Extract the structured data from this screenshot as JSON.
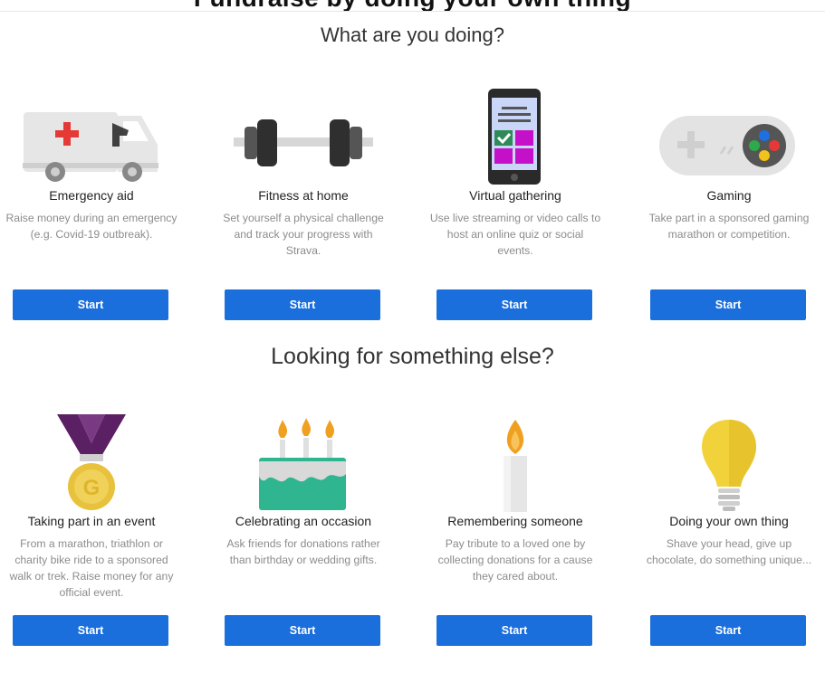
{
  "page": {
    "top_heading_partial": "Fundraise by doing your own thing",
    "section1_heading": "What are you doing?",
    "section2_heading": "Looking for something else?"
  },
  "section1": {
    "cards": [
      {
        "title": "Emergency aid",
        "desc": "Raise money during an emergency (e.g. Covid-19 outbreak).",
        "button": "Start",
        "icon": "ambulance-icon"
      },
      {
        "title": "Fitness at home",
        "desc": "Set yourself a physical challenge and track your progress with Strava.",
        "button": "Start",
        "icon": "dumbbell-icon"
      },
      {
        "title": "Virtual gathering",
        "desc": "Use live streaming or video calls to host an online quiz or social events.",
        "button": "Start",
        "icon": "smartphone-icon"
      },
      {
        "title": "Gaming",
        "desc": "Take part in a sponsored gaming marathon or competition.",
        "button": "Start",
        "icon": "gamepad-icon"
      }
    ]
  },
  "section2": {
    "cards": [
      {
        "title": "Taking part in an event",
        "desc": "From a marathon, triathlon or charity bike ride to a sponsored walk or trek. Raise money for any official event.",
        "button": "Start",
        "icon": "medal-icon"
      },
      {
        "title": "Celebrating an occasion",
        "desc": "Ask friends for donations rather than birthday or wedding gifts.",
        "button": "Start",
        "icon": "cake-icon"
      },
      {
        "title": "Remembering someone",
        "desc": "Pay tribute to a loved one by collecting donations for a cause they cared about.",
        "button": "Start",
        "icon": "candle-icon"
      },
      {
        "title": "Doing your own thing",
        "desc": "Shave your head, give up chocolate, do something unique...",
        "button": "Start",
        "icon": "lightbulb-icon"
      }
    ]
  },
  "colors": {
    "button_blue": "#1a6fdc",
    "desc_grey": "#8c8c8c",
    "medal_ribbon": "#5b1f63",
    "medal_gold": "#e8c23c",
    "cake_teal": "#2fb58f",
    "flame_orange": "#f0a020",
    "bulb_yellow": "#f2d23a",
    "phone_tile": "#c411c9"
  }
}
